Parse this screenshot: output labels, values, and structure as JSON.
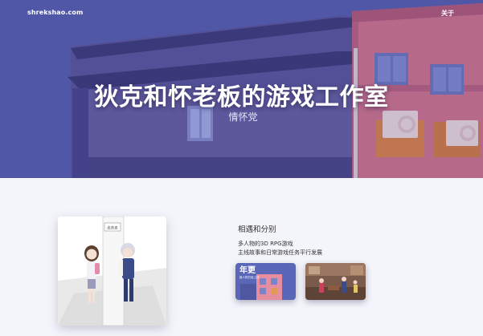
{
  "nav": {
    "brand": "shrekshao.com",
    "about": "关于"
  },
  "hero": {
    "title": "狄克和怀老板的游戏工作室",
    "subtitle": "情怀党"
  },
  "game": {
    "title": "相遇和分别",
    "lines": [
      "多人物的3D RPG游戏",
      "主线故事和日常游戏任务平行发展"
    ],
    "cover_sign_text": "出去走",
    "thumb1_text": "年更",
    "thumb1_small": "新人物已经上线"
  },
  "colors": {
    "hero": "#5a63b6",
    "building_pink": "#e9889c",
    "background": "#f4f5fb"
  }
}
